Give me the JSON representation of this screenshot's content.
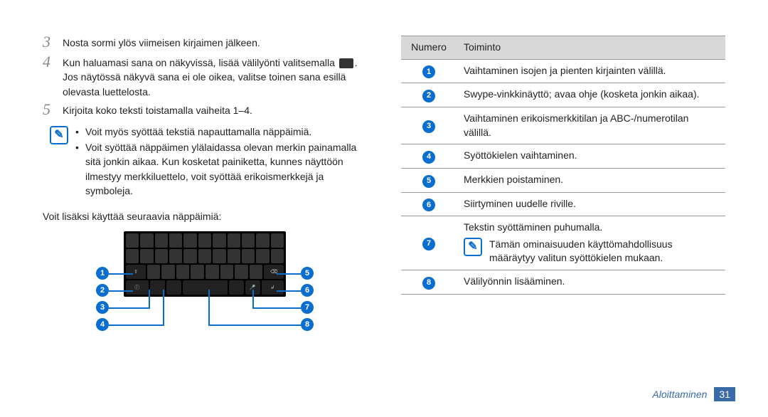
{
  "steps": {
    "s3": {
      "num": "3",
      "text": "Nosta sormi ylös viimeisen kirjaimen jälkeen."
    },
    "s4": {
      "num": "4",
      "text_before": "Kun haluamasi sana on näkyvissä, lisää välilyönti valitsemalla ",
      "text_after": ". Jos näytössä näkyvä sana ei ole oikea, valitse toinen sana esillä olevasta luettelosta."
    },
    "s5": {
      "num": "5",
      "text": "Kirjoita koko teksti toistamalla vaiheita 1–4."
    }
  },
  "note_bullets": {
    "b1": "Voit myös syöttää tekstiä napauttamalla näppäimiä.",
    "b2": "Voit syöttää näppäimen ylälaidassa olevan merkin painamalla sitä jonkin aikaa. Kun kosketat painiketta, kunnes näyttöön ilmestyy merkkiluettelo, voit syöttää erikoismerkkejä ja symboleja."
  },
  "extra_para": "Voit lisäksi käyttää seuraavia näppäimiä:",
  "callouts": {
    "c1": "1",
    "c2": "2",
    "c3": "3",
    "c4": "4",
    "c5": "5",
    "c6": "6",
    "c7": "7",
    "c8": "8"
  },
  "table": {
    "header": {
      "num": "Numero",
      "func": "Toiminto"
    },
    "rows": {
      "r1": {
        "n": "1",
        "t": "Vaihtaminen isojen ja pienten kirjainten välillä."
      },
      "r2": {
        "n": "2",
        "t": "Swype-vinkkinäyttö; avaa ohje (kosketa jonkin aikaa)."
      },
      "r3": {
        "n": "3",
        "t": "Vaihtaminen erikoismerkkitilan ja ABC-/numerotilan välillä."
      },
      "r4": {
        "n": "4",
        "t": "Syöttökielen vaihtaminen."
      },
      "r5": {
        "n": "5",
        "t": "Merkkien poistaminen."
      },
      "r6": {
        "n": "6",
        "t": "Siirtyminen uudelle riville."
      },
      "r7": {
        "n": "7",
        "t": "Tekstin syöttäminen puhumalla.",
        "note": "Tämän ominaisuuden käyttömahdollisuus määräytyy valitun syöttökielen mukaan."
      },
      "r8": {
        "n": "8",
        "t": "Välilyönnin lisääminen."
      }
    }
  },
  "footer": {
    "label": "Aloittaminen",
    "page": "31"
  }
}
